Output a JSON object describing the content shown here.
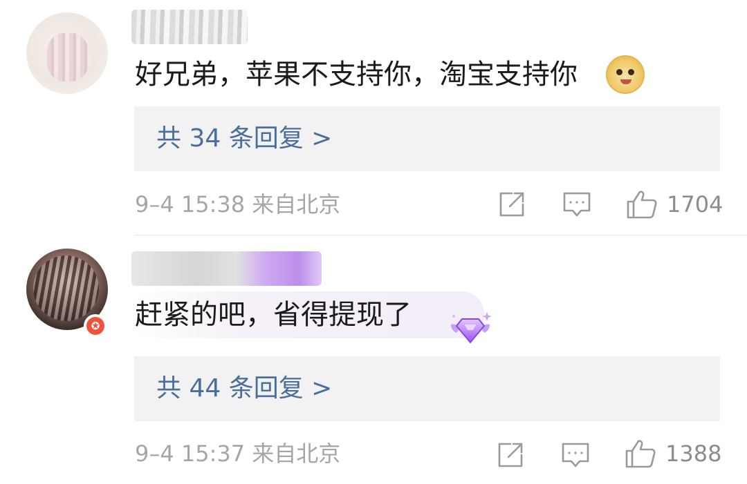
{
  "comments": [
    {
      "text": "好兄弟，苹果不支持你，淘宝支持你",
      "emoji_icon": "doge-emoji",
      "replies_label": "共 34 条回复 >",
      "meta": "9–4 15:38  来自北京",
      "likes": "1704"
    },
    {
      "text": "赶紧的吧，省得提现了",
      "badge_icon": "purple-gem-badge",
      "replies_label": "共 44 条回复 >",
      "meta": "9–4 15:37  来自北京",
      "likes": "1388"
    }
  ],
  "colors": {
    "reply_link": "#4a6e9c",
    "meta_gray": "#a6a6a6",
    "reply_bg": "#f2f2f2",
    "vip_badge": "#f0523a"
  }
}
